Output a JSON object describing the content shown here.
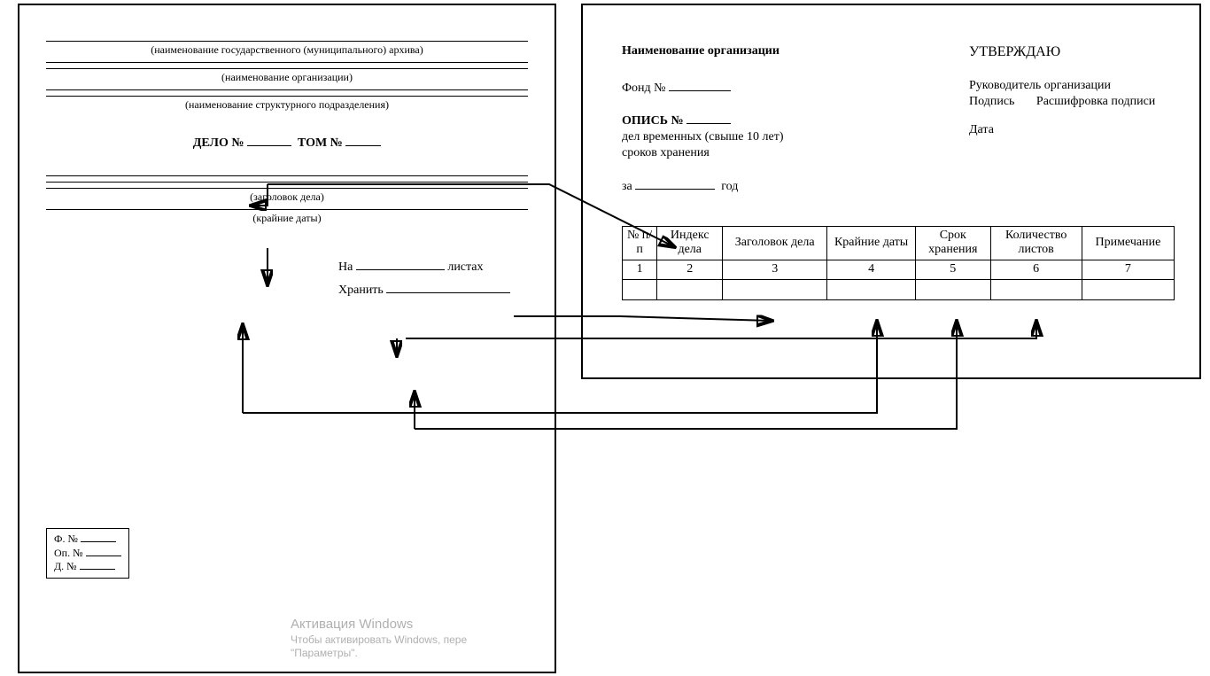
{
  "left": {
    "cap_archive": "(наименование государственного (муниципального) архива)",
    "cap_org": "(наименование организации)",
    "cap_unit": "(наименование структурного подразделения)",
    "delo_label": "ДЕЛО №",
    "tom_label": "ТОМ №",
    "cap_title": "(заголовок дела)",
    "cap_dates": "(крайние даты)",
    "na_label": "На",
    "sheets_label": "листах",
    "store_label": "Хранить",
    "corner_f": "Ф. №",
    "corner_op": "Оп. №",
    "corner_d": "Д. №"
  },
  "right": {
    "org_label": "Наименование организации",
    "approve": "УТВЕРЖДАЮ",
    "head_label": "Руководитель организации",
    "sign_label": "Подпись",
    "decipher_label": "Расшифровка подписи",
    "date_label": "Дата",
    "fund_label": "Фонд №",
    "opis_label": "ОПИСЬ №",
    "opis_sub1": "дел временных (свыше 10 лет)",
    "opis_sub2": "сроков хранения",
    "za_label": "за",
    "year_label": "год",
    "columns": [
      "№ п/п",
      "Индекс дела",
      "Заголовок дела",
      "Крайние даты",
      "Срок хранения",
      "Количество листов",
      "Примечание"
    ],
    "colnums": [
      "1",
      "2",
      "3",
      "4",
      "5",
      "6",
      "7"
    ]
  },
  "watermark": {
    "l1": "Активация Windows",
    "l2": "Чтобы активировать Windows, пере",
    "l3": "\"Параметры\"."
  }
}
